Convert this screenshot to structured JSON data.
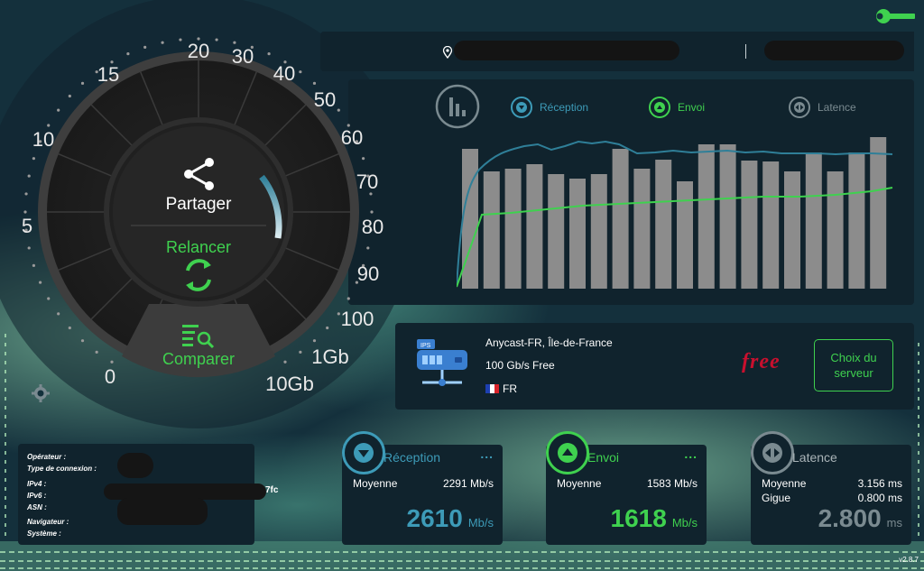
{
  "app": {
    "version": "v2.8.7"
  },
  "gauge": {
    "scale_labels": [
      "0",
      "5",
      "10",
      "15",
      "20",
      "30",
      "40",
      "50",
      "60",
      "70",
      "80",
      "90",
      "100",
      "1Gb",
      "10Gb"
    ],
    "share_label": "Partager",
    "rerun_label": "Relancer",
    "compare_label": "Comparer"
  },
  "chart_legend": {
    "reception": "Réception",
    "upload": "Envoi",
    "latency": "Latence"
  },
  "chart_data": {
    "type": "bar",
    "categories": [],
    "values": [],
    "series_note": ""
  },
  "server": {
    "name": "Anycast-FR, Île-de-France",
    "capacity": "100 Gb/s Free",
    "country": "FR",
    "provider_logo": "free",
    "choose_button": "Choix du serveur"
  },
  "info": {
    "operator_label": "Opérateur :",
    "connection_type_label": "Type de connexion :",
    "ipv4_label": "IPv4 :",
    "ipv6_label": "IPv6 :",
    "asn_label": "ASN :",
    "browser_label": "Navigateur :",
    "system_label": "Système :",
    "ipv6_tail": "7fc"
  },
  "reception": {
    "title": "Réception",
    "more": "...",
    "avg_label": "Moyenne",
    "avg_value": "2291 Mb/s",
    "value": "2610",
    "unit": "Mb/s"
  },
  "upload": {
    "title": "Envoi",
    "more": "...",
    "avg_label": "Moyenne",
    "avg_value": "1583 Mb/s",
    "value": "1618",
    "unit": "Mb/s"
  },
  "latency": {
    "title": "Latence",
    "avg_label": "Moyenne",
    "avg_value": "3.156 ms",
    "jitter_label": "Gigue",
    "jitter_value": "0.800 ms",
    "value": "2.800",
    "unit": "ms"
  },
  "colors": {
    "reception": "#3d9bb8",
    "upload": "#3fd14f",
    "latency": "#7a8a90",
    "panel": "#10232d"
  }
}
